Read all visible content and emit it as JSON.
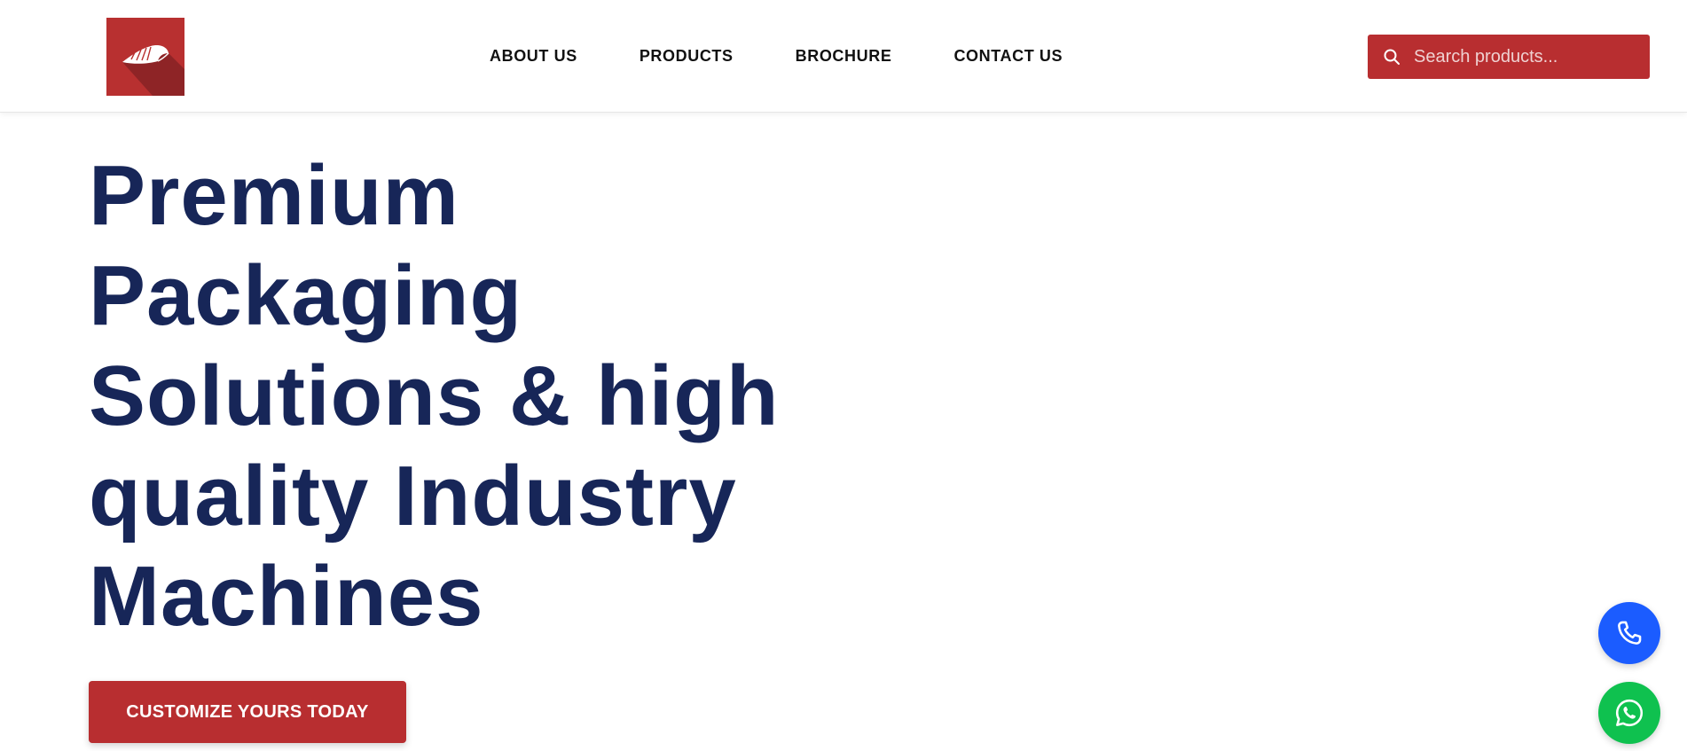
{
  "header": {
    "logo_icon": "conch-shell-logo",
    "nav": [
      {
        "label": "ABOUT US"
      },
      {
        "label": "PRODUCTS"
      },
      {
        "label": "BROCHURE"
      },
      {
        "label": "CONTACT US"
      }
    ],
    "search": {
      "placeholder": "Search products...",
      "value": "",
      "icon": "search-icon"
    }
  },
  "hero": {
    "title": "Premium Packaging Solutions & high quality Industry Machines",
    "cta_label": "CUSTOMIZE YOURS TODAY"
  },
  "floating_actions": {
    "phone_icon": "phone-icon",
    "whatsapp_icon": "whatsapp-icon"
  },
  "colors": {
    "brand_red": "#b82e30",
    "title_navy": "#172658",
    "phone_blue": "#1b5cff",
    "whatsapp_green": "#0fc14f"
  }
}
